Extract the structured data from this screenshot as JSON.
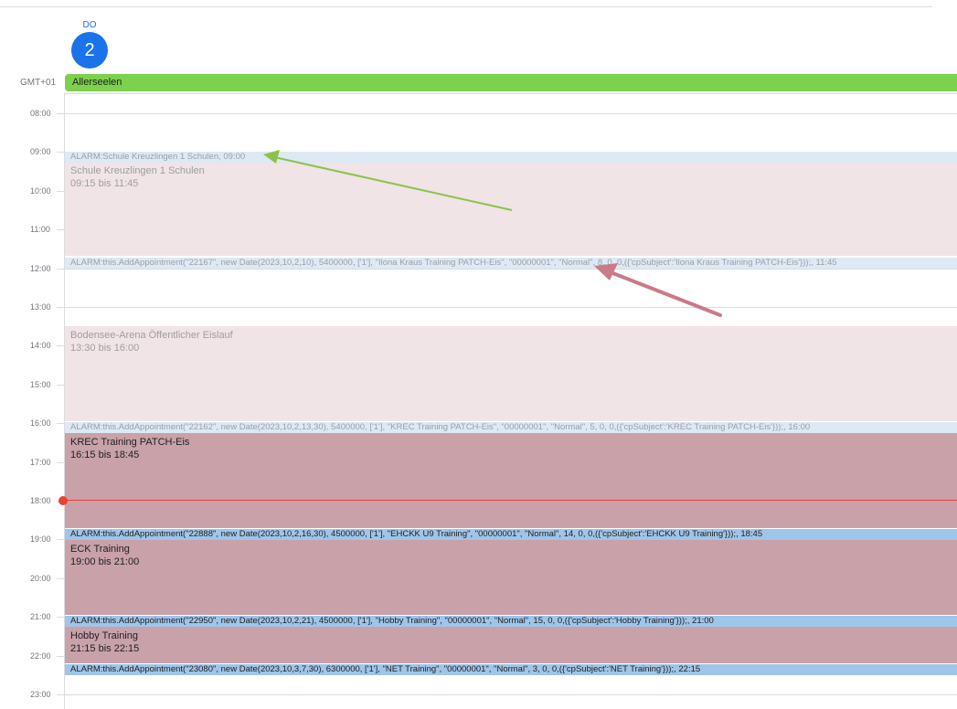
{
  "day": {
    "weekday": "DO",
    "date": "2"
  },
  "timezone": "GMT+01",
  "allday_event": {
    "title": "Allerseelen",
    "color": "#7cd24d"
  },
  "hours": [
    "08:00",
    "09:00",
    "10:00",
    "11:00",
    "12:00",
    "13:00",
    "14:00",
    "15:00",
    "16:00",
    "17:00",
    "18:00",
    "19:00",
    "20:00",
    "21:00",
    "22:00",
    "23:00"
  ],
  "events": {
    "schule": {
      "title": "Schule Kreuzlingen 1 Schulen",
      "time": "09:15 bis 11:45"
    },
    "bodensee": {
      "title": "Bodensee-Arena Öffentlicher Eislauf",
      "time": "13:30 bis 16:00"
    },
    "krec": {
      "title": "KREC Training PATCH-Eis",
      "time": "16:15 bis 18:45"
    },
    "eck": {
      "title": "ECK Training",
      "time": "19:00 bis 21:00"
    },
    "hobby": {
      "title": "Hobby Training",
      "time": "21:15 bis 22:15"
    }
  },
  "alarms": {
    "a1": "ALARM:Schule Kreuzlingen 1 Schulen, 09:00",
    "a2": "ALARM:this.AddAppointment(\"22167\", new Date(2023,10,2,10), 5400000, ['1'], \"Ilona Kraus Training PATCH-Eis\", \"00000001\", \"Normal\", 8, 0, 0,({'cpSubject':'Ilona Kraus Training PATCH-Eis'}));, 11:45",
    "a3": "ALARM:this.AddAppointment(\"22162\", new Date(2023,10,2,13,30), 5400000, ['1'], \"KREC Training PATCH-Eis\", \"00000001\", \"Normal\", 5, 0, 0,({'cpSubject':'KREC Training PATCH-Eis'}));, 16:00",
    "a4": "ALARM:this.AddAppointment(\"22888\", new Date(2023,10,2,16,30), 4500000, ['1'], \"EHCKK U9 Training\", \"00000001\", \"Normal\", 14, 0, 0,({'cpSubject':'EHCKK U9 Training'}));, 18:45",
    "a5": "ALARM:this.AddAppointment(\"22950\", new Date(2023,10,2,21), 4500000, ['1'], \"Hobby Training\", \"00000001\", \"Normal\", 15, 0, 0,({'cpSubject':'Hobby Training'}));, 21:00",
    "a6": "ALARM:this.AddAppointment(\"23080\", new Date(2023,10,3,7,30), 6300000, ['1'], \"NET Training\", \"00000001\", \"Normal\", 3, 0, 0,({'cpSubject':'NET Training'}));, 22:15"
  },
  "colors": {
    "accent": "#1a73e8",
    "faded_event": "#f0e4e6",
    "dark_event": "#c9a1a9",
    "faded_alarm": "#dde9f4",
    "dark_alarm": "#9fc5e8",
    "now_indicator": "#ea4335",
    "arrow_green": "#8bc34a",
    "arrow_red": "#c97b87"
  }
}
